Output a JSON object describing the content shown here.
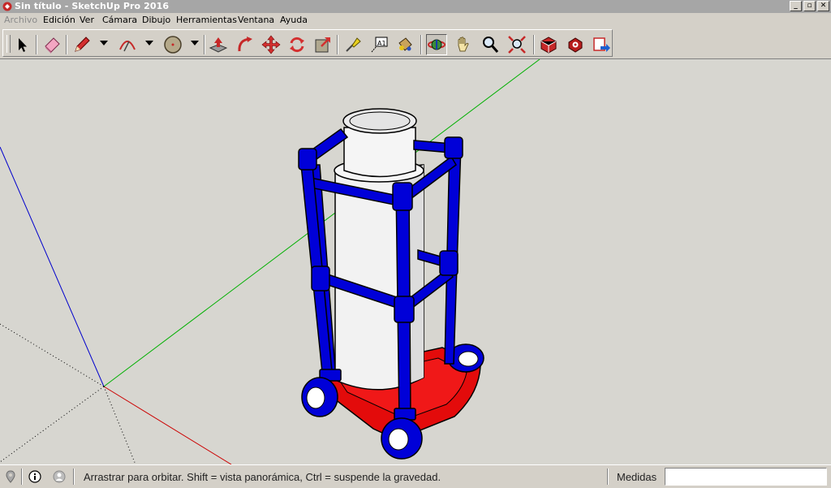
{
  "window": {
    "title": "Sin título - SketchUp Pro 2016",
    "buttons": [
      "_",
      "▫",
      "✕"
    ]
  },
  "menus": [
    {
      "label": "Archivo",
      "disabled": true
    },
    {
      "label": "Edición",
      "disabled": false
    },
    {
      "label": "Ver",
      "disabled": false
    },
    {
      "label": "Cámara",
      "disabled": false
    },
    {
      "label": "Dibujo",
      "disabled": false
    },
    {
      "label": "Herramientas",
      "disabled": false
    },
    {
      "label": "Ventana",
      "disabled": false
    },
    {
      "label": "Ayuda",
      "disabled": false
    }
  ],
  "toolbar": {
    "tools": [
      "select-tool",
      "eraser-tool",
      "pencil-line-tool",
      "arc-tool",
      "shape-tool",
      "push-pull-tool",
      "follow-me-tool",
      "move-tool",
      "rotate-tool",
      "scale-tool",
      "tape-measure-tool",
      "text-tool",
      "paint-bucket-tool",
      "orbit-tool",
      "pan-tool",
      "zoom-tool",
      "zoom-extents-tool",
      "warehouse-tool",
      "extension-warehouse-tool",
      "share-model-tool"
    ],
    "active_tool": "orbit-tool",
    "text_tool_glyph": "A1"
  },
  "colors": {
    "frame_blue": "#0000d8",
    "base_red": "#e30b0b",
    "cylinder": "#f2f2f2",
    "axis_red": "#cc0000",
    "axis_green": "#00b000",
    "axis_blue": "#0000cc",
    "viewport_bg": "#d7d6d0"
  },
  "status": {
    "hint": "Arrastrar para orbitar. Shift = vista panorámica, Ctrl = suspende la gravedad.",
    "measure_label": "Medidas",
    "measure_value": ""
  }
}
